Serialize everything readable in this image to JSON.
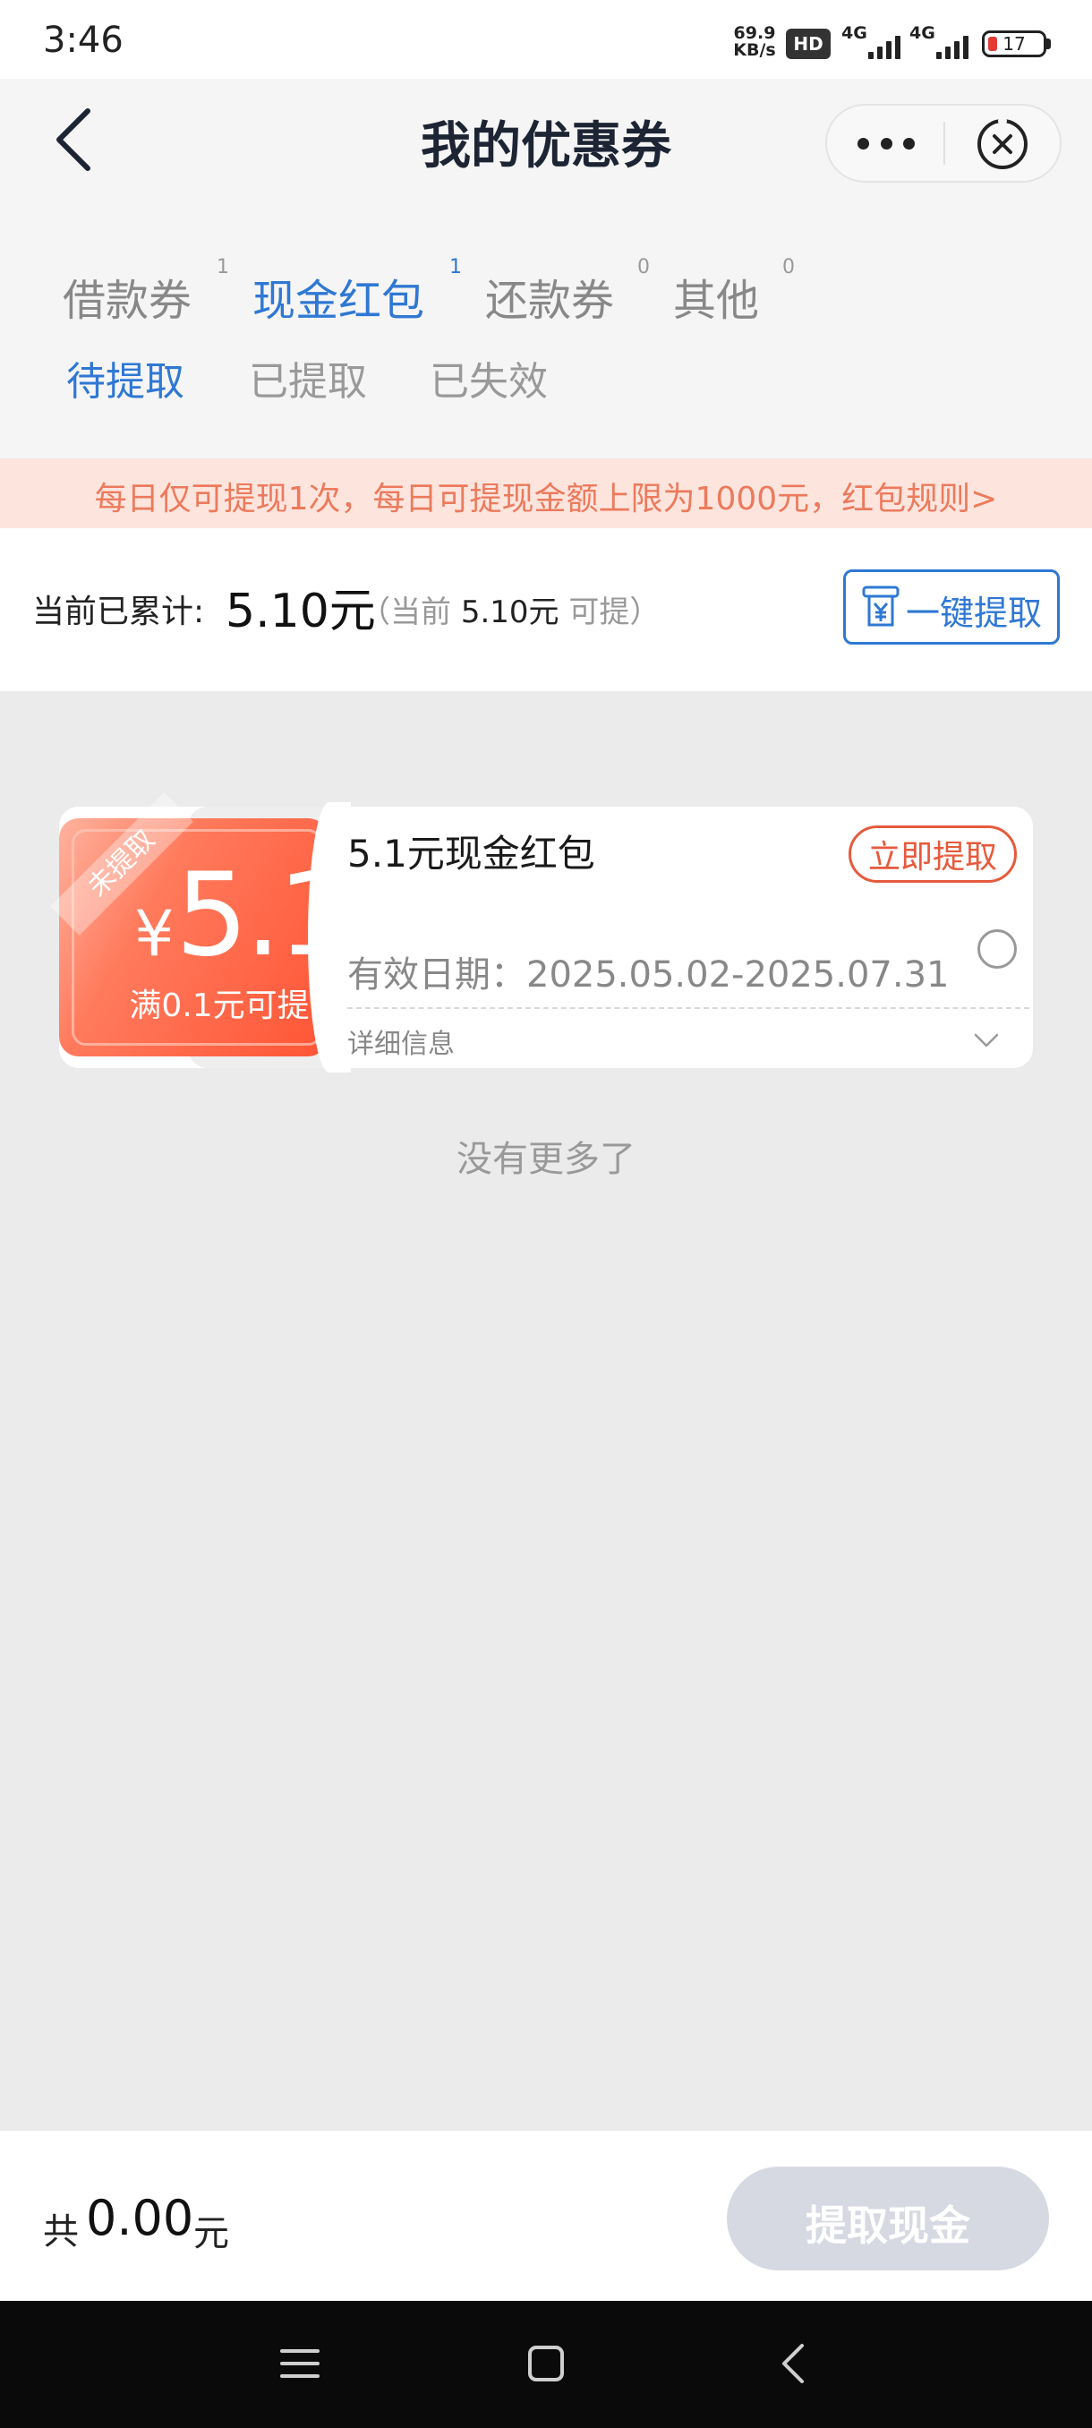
{
  "status_bar": {
    "time": "3:46",
    "net_speed_value": "69.9",
    "net_speed_unit": "KB/s",
    "hd_badge": "HD",
    "network_1": "4G",
    "network_2": "4G",
    "battery": "17"
  },
  "header": {
    "title": "我的优惠券",
    "back_icon": "chevron-left-icon",
    "more_icon": "more-dots-icon",
    "close_icon": "close-circle-icon"
  },
  "tabs": [
    {
      "label": "借款券",
      "count": "1",
      "active": false
    },
    {
      "label": "现金红包",
      "count": "1",
      "active": true
    },
    {
      "label": "还款券",
      "count": "0",
      "active": false
    },
    {
      "label": "其他",
      "count": "0",
      "active": false
    }
  ],
  "subtabs": [
    {
      "label": "待提取",
      "active": true
    },
    {
      "label": "已提取",
      "active": false
    },
    {
      "label": "已失效",
      "active": false
    }
  ],
  "notice": {
    "text": "每日仅可提现1次，每日可提现金额上限为1000元，红包规则>"
  },
  "summary": {
    "label": "当前已累计:",
    "amount": "5.10元",
    "note_prefix": "（当前",
    "note_amount": "5.10元",
    "note_suffix": "可提）",
    "withdraw_all_label": "一键提取"
  },
  "coupon": {
    "ribbon": "未提取",
    "currency": "¥",
    "amount": "5.1",
    "condition": "满0.1元可提",
    "title": "5.1元现金红包",
    "claim_label": "立即提取",
    "validity": "有效日期：2025.05.02-2025.07.31",
    "details_label": "详细信息",
    "selected": false
  },
  "list_end": "没有更多了",
  "footer": {
    "total_prefix": "共",
    "total_amount": "0.00",
    "total_unit": "元",
    "cash_button_label": "提取现金"
  },
  "colors": {
    "accent_blue": "#2f78d4",
    "coupon_red": "#ff5535",
    "claim_red": "#e65a3c",
    "notice_bg": "#fde5de",
    "notice_text": "#ec7a5c",
    "disabled_button": "#d6d9e2"
  }
}
